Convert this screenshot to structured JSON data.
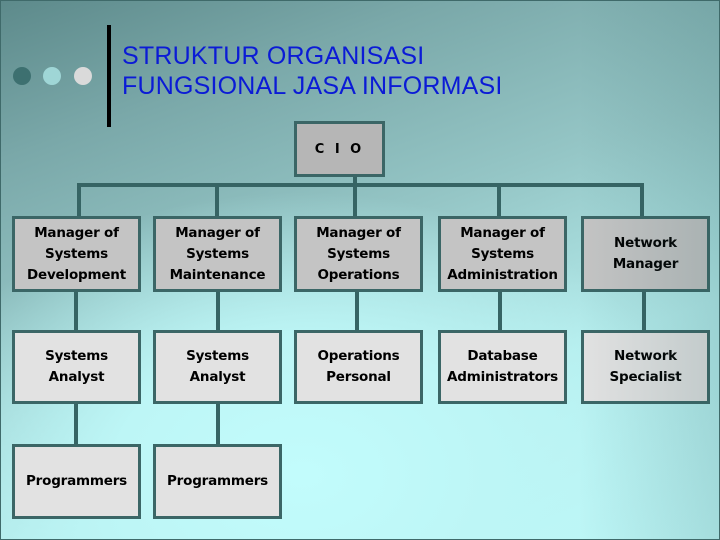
{
  "slide": {
    "title_lines": [
      "STRUKTUR ORGANISASI",
      "FUNGSIONAL JASA INFORMASI"
    ],
    "decorative_dots": [
      "dark-teal",
      "light-teal",
      "light-gray"
    ],
    "colors": {
      "title_text": "#0b1bd6",
      "connector": "#366464",
      "box_border": "#3b6666",
      "manager_fill": "#c4c4c4",
      "staff_fill": "#e2e2e2",
      "cio_fill": "#b6b6b6"
    }
  },
  "org_chart": {
    "root": {
      "label": "C I O"
    },
    "departments": [
      {
        "manager": "Manager of\nSystems\nDevelopment",
        "staff": [
          "Systems\nAnalyst",
          "Programmers"
        ]
      },
      {
        "manager": "Manager of\nSystems\nMaintenance",
        "staff": [
          "Systems\nAnalyst",
          "Programmers"
        ]
      },
      {
        "manager": "Manager of\nSystems\nOperations",
        "staff": [
          "Operations\nPersonal"
        ]
      },
      {
        "manager": "Manager of\nSystems\nAdministration",
        "staff": [
          "Database\nAdministrators"
        ]
      },
      {
        "manager": "Network\nManager",
        "staff": [
          "Network\nSpecialist"
        ]
      }
    ]
  }
}
